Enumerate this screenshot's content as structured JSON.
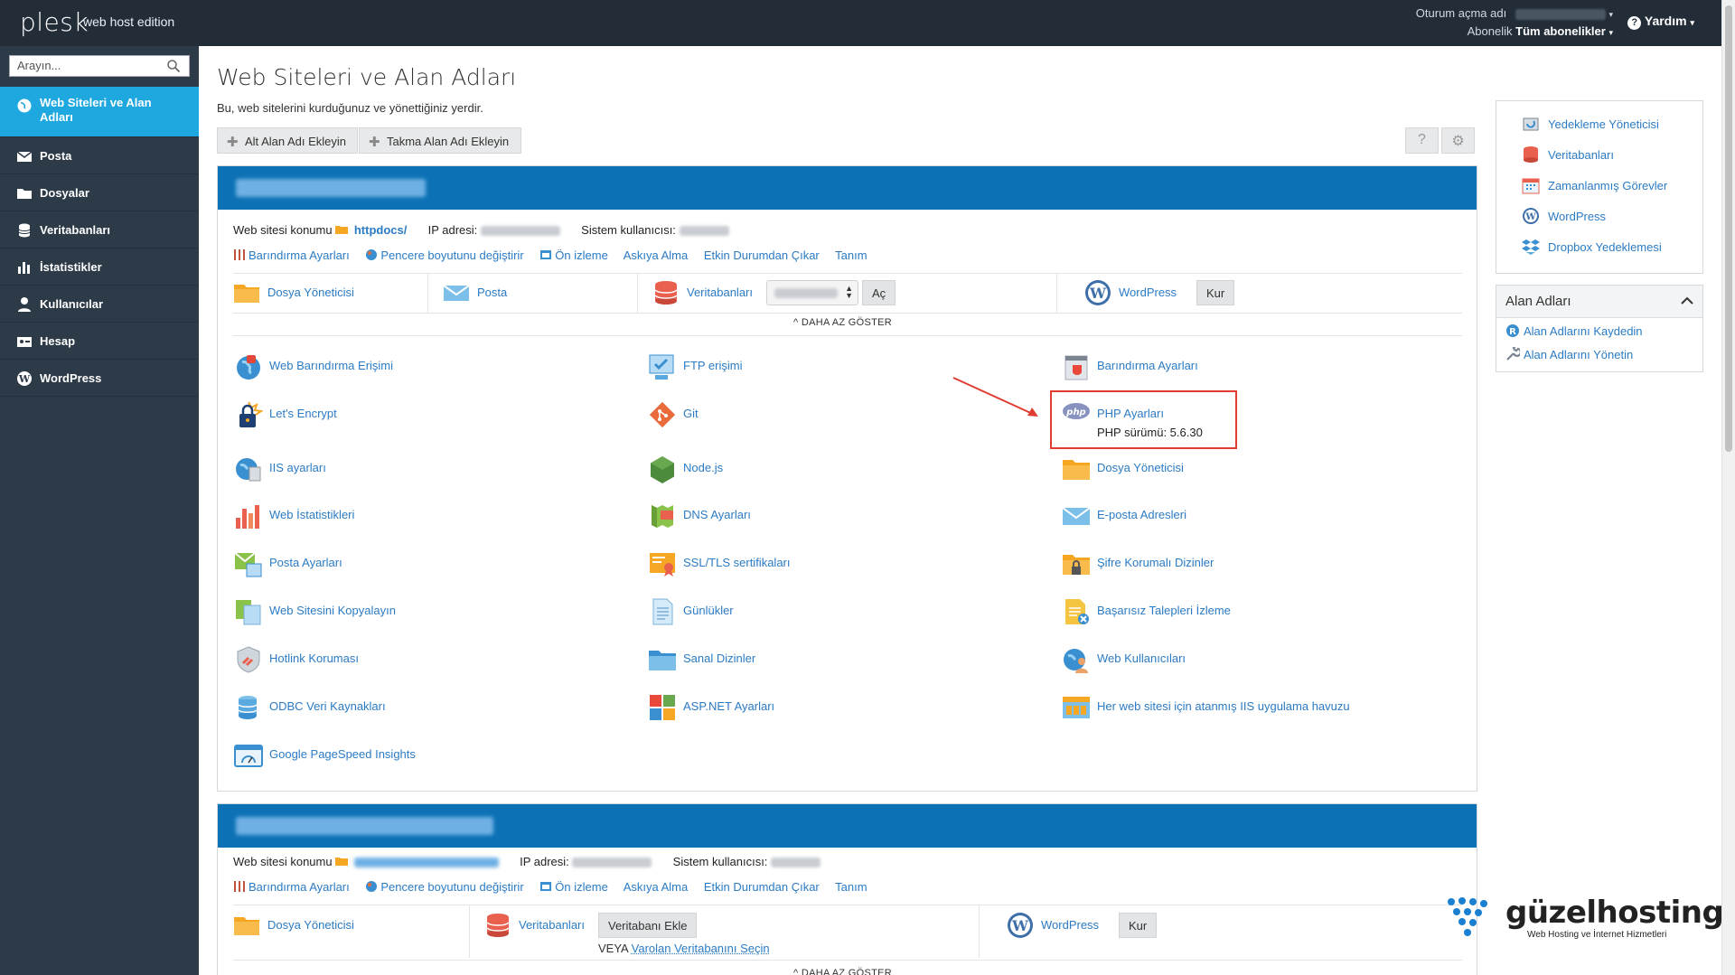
{
  "topbar": {
    "logo": "plesk",
    "edition": "web host edition",
    "login_label": "Oturum açma adı",
    "subscription_label": "Abonelik",
    "subscription_value": "Tüm abonelikler",
    "help": "Yardım"
  },
  "sidebar": {
    "search_placeholder": "Arayın...",
    "items": [
      {
        "label": "Web Siteleri ve Alan Adları",
        "icon": "globe-icon"
      },
      {
        "label": "Posta",
        "icon": "mail-icon"
      },
      {
        "label": "Dosyalar",
        "icon": "folder-icon"
      },
      {
        "label": "Veritabanları",
        "icon": "database-icon"
      },
      {
        "label": "İstatistikler",
        "icon": "bar-chart-icon"
      },
      {
        "label": "Kullanıcılar",
        "icon": "user-icon"
      },
      {
        "label": "Hesap",
        "icon": "account-icon"
      },
      {
        "label": "WordPress",
        "icon": "wordpress-icon"
      }
    ]
  },
  "main": {
    "title": "Web Siteleri ve Alan Adları",
    "subtitle": "Bu, web sitelerini kurduğunuz ve yönettiğiniz yerdir.",
    "toolbar": {
      "add_subdomain": "Alt Alan Adı Ekleyin",
      "add_alias": "Takma Alan Adı Ekleyin",
      "help_btn": "?",
      "settings_btn": "⚙"
    }
  },
  "card1": {
    "info": {
      "location_label": "Web sitesi konumu",
      "location_value": "httpdocs/",
      "ip_label": "IP adresi:",
      "user_label": "Sistem kullanıcısı:"
    },
    "links": [
      "Barındırma Ayarları",
      "Pencere boyutunu değiştirir",
      "Ön izleme",
      "Askıya Alma",
      "Etkin Durumdan Çıkar",
      "Tanım"
    ],
    "quick": {
      "files": "Dosya Yöneticisi",
      "mail": "Posta",
      "databases": "Veritabanları",
      "open_btn": "Aç",
      "wordpress": "WordPress",
      "install_btn": "Kur"
    },
    "toggle": "DAHA AZ GÖSTER",
    "tools_col1": [
      "Web Barındırma Erişimi",
      "Let's Encrypt",
      "IIS ayarları",
      "Web İstatistikleri",
      "Posta Ayarları",
      "Web Sitesini Kopyalayın",
      "Hotlink Koruması",
      "ODBC Veri Kaynakları",
      "Google PageSpeed Insights"
    ],
    "tools_col2": [
      "FTP erişimi",
      "Git",
      "Node.js",
      "DNS Ayarları",
      "SSL/TLS sertifikaları",
      "Günlükler",
      "Sanal Dizinler",
      "ASP.NET Ayarları"
    ],
    "tools_col3": [
      "Barındırma Ayarları",
      "PHP Ayarları",
      "Dosya Yöneticisi",
      "E-posta Adresleri",
      "Şifre Korumalı Dizinler",
      "Başarısız Talepleri İzleme",
      "Web Kullanıcıları",
      "Her web sitesi için atanmış IIS uygulama havuzu"
    ],
    "php_version": "PHP sürümü: 5.6.30"
  },
  "card2": {
    "info": {
      "location_label": "Web sitesi konumu",
      "ip_label": "IP adresi:",
      "user_label": "Sistem kullanıcısı:"
    },
    "links": [
      "Barındırma Ayarları",
      "Pencere boyutunu değiştirir",
      "Ön izleme",
      "Askıya Alma",
      "Etkin Durumdan Çıkar",
      "Tanım"
    ],
    "quick": {
      "files": "Dosya Yöneticisi",
      "databases": "Veritabanları",
      "add_db_btn": "Veritabanı Ekle",
      "or_label": "VEYA",
      "select_db": "Varolan Veritabanını Seçin",
      "wordpress": "WordPress",
      "install_btn": "Kur"
    },
    "toggle": "DAHA AZ GÖSTER"
  },
  "right_panel": {
    "items": [
      "Yedekleme Yöneticisi",
      "Veritabanları",
      "Zamanlanmış Görevler",
      "WordPress",
      "Dropbox Yedeklemesi"
    ],
    "domains_title": "Alan Adları",
    "domain_items": [
      "Alan Adlarını Kaydedin",
      "Alan Adlarını Yönetin"
    ]
  },
  "watermark": {
    "brand": "güzelhosting",
    "tagline": "Web Hosting ve İnternet Hizmetleri"
  }
}
